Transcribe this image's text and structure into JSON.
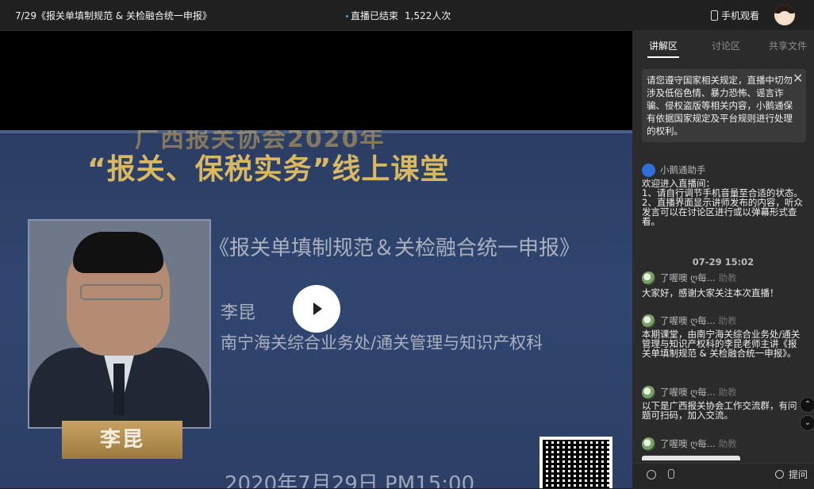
{
  "topbar": {
    "title": "7/29《报关单填制规范 & 关检融合统一申报》",
    "status": "直播已结束",
    "viewers": "1,522人次",
    "mobile_label": "手机观看"
  },
  "slide": {
    "top_partial": "广西报关协会2020年",
    "headline": "“报关、保税实务”线上课堂",
    "subtitle": "《报关单填制规范＆关检融合统一申报》",
    "speaker": "李昆",
    "dept": "南宁海关综合业务处/通关管理与知识产权科",
    "name_plaque": "李昆",
    "date": "2020年7月29日    PM15:00"
  },
  "panel": {
    "tabs": [
      "讲解区",
      "讨论区",
      "共享文件"
    ],
    "notice": "请您遵守国家相关规定，直播中切勿涉及低俗色情、暴力恐怖、谣言诈骗、侵权盗版等相关内容，小鹅通保有依据国家规定及平台规则进行处理的权利。",
    "messages": [
      {
        "name": "小鹅通助手",
        "role": "",
        "body": "欢迎进入直播间：\n1、请自行调节手机音量至合适的状态。\n2、直播界面显示讲师发布的内容，听众发言可以在讨论区进行或以弹幕形式查看。"
      },
      {
        "time": "07-29 15:02"
      },
      {
        "name": "了喔噢 ღ每...",
        "role": "助教",
        "body": "大家好，感谢大家关注本次直播！"
      },
      {
        "name": "了喔噢 ღ每...",
        "role": "助教",
        "body": "本期课堂，由南宁海关综合业务处/通关管理与知识产权科的李昆老师主讲《报关单填制规范 & 关检融合统一申报》。"
      },
      {
        "name": "了喔噢 ღ每...",
        "role": "助教",
        "body": "以下是广西报关协会工作交流群，有问题可扫码，加入交流。"
      },
      {
        "name": "了喔噢 ღ每...",
        "role": "助教",
        "body": ""
      }
    ],
    "ask_label": "提问"
  }
}
